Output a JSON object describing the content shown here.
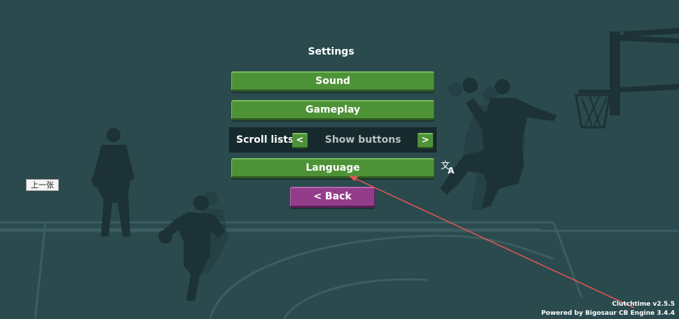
{
  "menu": {
    "title": "Settings",
    "sound_label": "Sound",
    "gameplay_label": "Gameplay",
    "scroll_lists": {
      "label": "Scroll lists",
      "prev_glyph": "<",
      "value": "Show buttons",
      "next_glyph": ">"
    },
    "language_label": "Language",
    "back_label": "< Back"
  },
  "language_icon": {
    "name": "translate-icon",
    "glyph_a": "文",
    "glyph_b": "A"
  },
  "overlay": {
    "prev_tooltip": "上一张",
    "annotation_arrow_color": "#e05555"
  },
  "footer": {
    "version": "Clutchtime v2.5.5",
    "powered_by": "Powered by Bigosaur CB Engine 3.4.4"
  },
  "colors": {
    "background": "#2a4a4e",
    "silhouette": "#1d3236",
    "court_lines": "#3b5e62",
    "green_button": "#4e9238",
    "purple_button": "#933d8a",
    "scroll_row_bg": "#172a2e"
  }
}
